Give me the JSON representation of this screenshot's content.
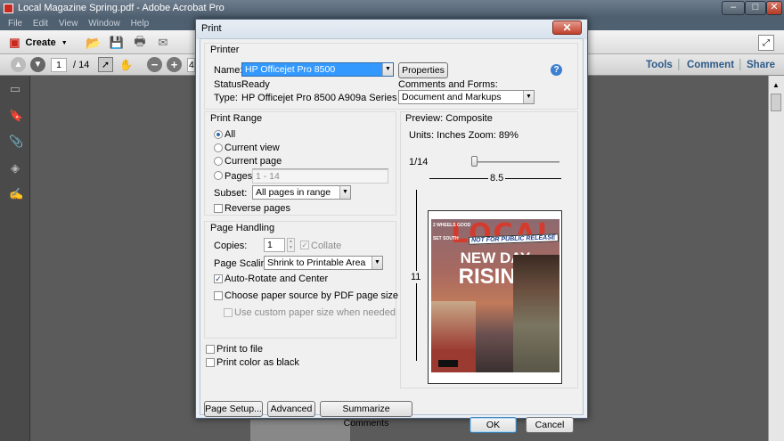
{
  "window": {
    "title": "Local Magazine Spring.pdf - Adobe Acrobat Pro"
  },
  "menu": [
    "File",
    "Edit",
    "View",
    "Window",
    "Help"
  ],
  "toolbar": {
    "create_label": "Create",
    "page_current": "1",
    "page_total": "/ 14",
    "zoom_partial": "4"
  },
  "right_links": {
    "tools": "Tools",
    "comment": "Comment",
    "share": "Share"
  },
  "dialog": {
    "title": "Print",
    "printer": {
      "group": "Printer",
      "name_label": "Name:",
      "name_value": "HP Officejet Pro 8500",
      "properties": "Properties",
      "status_label": "Status:",
      "status_value": "Ready",
      "type_label": "Type:",
      "type_value": "HP Officejet Pro 8500 A909a Series",
      "comments_label": "Comments and Forms:",
      "comments_value": "Document and Markups"
    },
    "range": {
      "group": "Print Range",
      "all": "All",
      "current_view": "Current view",
      "current_page": "Current page",
      "pages": "Pages",
      "pages_value": "1 - 14",
      "subset_label": "Subset:",
      "subset_value": "All pages in range",
      "reverse": "Reverse pages"
    },
    "handling": {
      "group": "Page Handling",
      "copies_label": "Copies:",
      "copies_value": "1",
      "collate": "Collate",
      "scaling_label": "Page Scaling:",
      "scaling_value": "Shrink to Printable Area",
      "auto_rotate": "Auto-Rotate and Center",
      "paper_source": "Choose paper source by PDF page size",
      "custom_size": "Use custom paper size when needed"
    },
    "print_to_file": "Print to file",
    "color_as_black": "Print color as black",
    "preview": {
      "group": "Preview: Composite",
      "units": "Units: Inches Zoom:  89%",
      "page_index": "1/14",
      "width": "8.5",
      "height": "11"
    },
    "magazine": {
      "logo": "LOCAL",
      "badge": "NOT FOR PUBLIC RELEASE",
      "headline1": "NEW DAY",
      "headline2": "RISING",
      "corner1": "2 WHEELS GOOD",
      "corner2": "SET SOUTH"
    },
    "buttons": {
      "page_setup": "Page Setup...",
      "advanced": "Advanced",
      "summarize": "Summarize Comments",
      "ok": "OK",
      "cancel": "Cancel"
    }
  },
  "colors": {
    "accent": "#3399ff",
    "selection": "#3399ff",
    "link": "#2c5a88"
  }
}
